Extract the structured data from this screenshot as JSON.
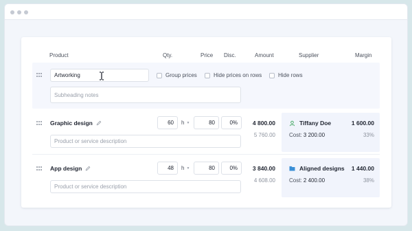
{
  "headers": {
    "product": "Product",
    "qty": "Qty.",
    "price": "Price",
    "disc": "Disc.",
    "amount": "Amount",
    "supplier": "Supplier",
    "margin": "Margin"
  },
  "heading_row": {
    "name_value": "Artworking",
    "notes_placeholder": "Subheading notes",
    "options": [
      "Group prices",
      "Hide prices on rows",
      "Hide rows"
    ]
  },
  "rows": [
    {
      "name": "Graphic design",
      "description_placeholder": "Product or service description",
      "qty": "60",
      "unit": "h",
      "price": "80",
      "discount": "0%",
      "amount": "4 800.00",
      "amount_secondary": "5 760.00",
      "supplier": "Tiffany Doe",
      "supplier_icon": "person-icon",
      "cost_label": "Cost:",
      "cost_value": "3 200.00",
      "margin_value": "1 600.00",
      "margin_pct": "33%"
    },
    {
      "name": "App design",
      "description_placeholder": "Product or service description",
      "qty": "48",
      "unit": "h",
      "price": "80",
      "discount": "0%",
      "amount": "3 840.00",
      "amount_secondary": "4 608.00",
      "supplier": "Aligned designs",
      "supplier_icon": "folder-icon",
      "cost_label": "Cost:",
      "cost_value": "2 400.00",
      "margin_value": "1 440.00",
      "margin_pct": "38%"
    }
  ],
  "colors": {
    "background": "#d7e7ea",
    "accent_green": "#3aa35a",
    "accent_blue": "#3b8fd6"
  }
}
